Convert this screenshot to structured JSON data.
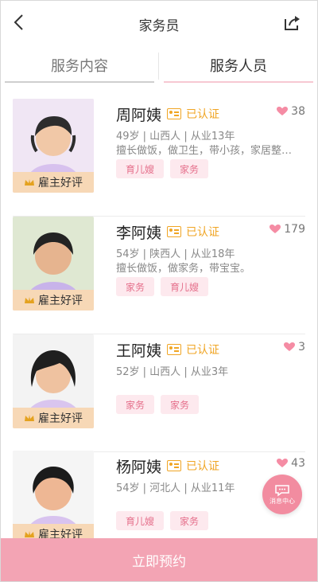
{
  "header": {
    "title": "家务员"
  },
  "tabs": [
    {
      "label": "服务内容",
      "active": false
    },
    {
      "label": "服务人员",
      "active": true
    }
  ],
  "badge_label": "雇主好评",
  "verified_label": "已认证",
  "people": [
    {
      "name": "周阿姨",
      "likes": "38",
      "meta": "49岁 | 山西人 | 从业13年",
      "desc": "擅长做饭，做卫生，带小孩，家居整…",
      "tags": [
        "育儿嫂",
        "家务"
      ],
      "verified": true
    },
    {
      "name": "李阿姨",
      "likes": "179",
      "meta": "54岁 | 陕西人 | 从业18年",
      "desc": "擅长做饭，做家务，带宝宝。",
      "tags": [
        "家务",
        "育儿嫂"
      ],
      "verified": true
    },
    {
      "name": "王阿姨",
      "likes": "3",
      "meta": "52岁 | 山西人 | 从业3年",
      "desc": "",
      "tags": [
        "家务",
        "家务"
      ],
      "verified": true
    },
    {
      "name": "杨阿姨",
      "likes": "43",
      "meta": "54岁 | 河北人 | 从业11年",
      "desc": "",
      "tags": [
        "育儿嫂",
        "家务"
      ],
      "verified": true
    }
  ],
  "floating": {
    "label": "消息中心"
  },
  "cta": {
    "label": "立即预约"
  },
  "colors": {
    "accent": "#f3a4b4",
    "verified": "#f0a524",
    "tag_bg": "#fde9ee",
    "tag_text": "#e56f8b",
    "badge_bg": "#f7d8b6"
  },
  "icons": {
    "back": "chevron-left-icon",
    "share": "share-icon",
    "heart": "heart-icon",
    "id_card": "id-card-icon",
    "crown": "crown-icon",
    "message": "chat-bubble-icon"
  }
}
